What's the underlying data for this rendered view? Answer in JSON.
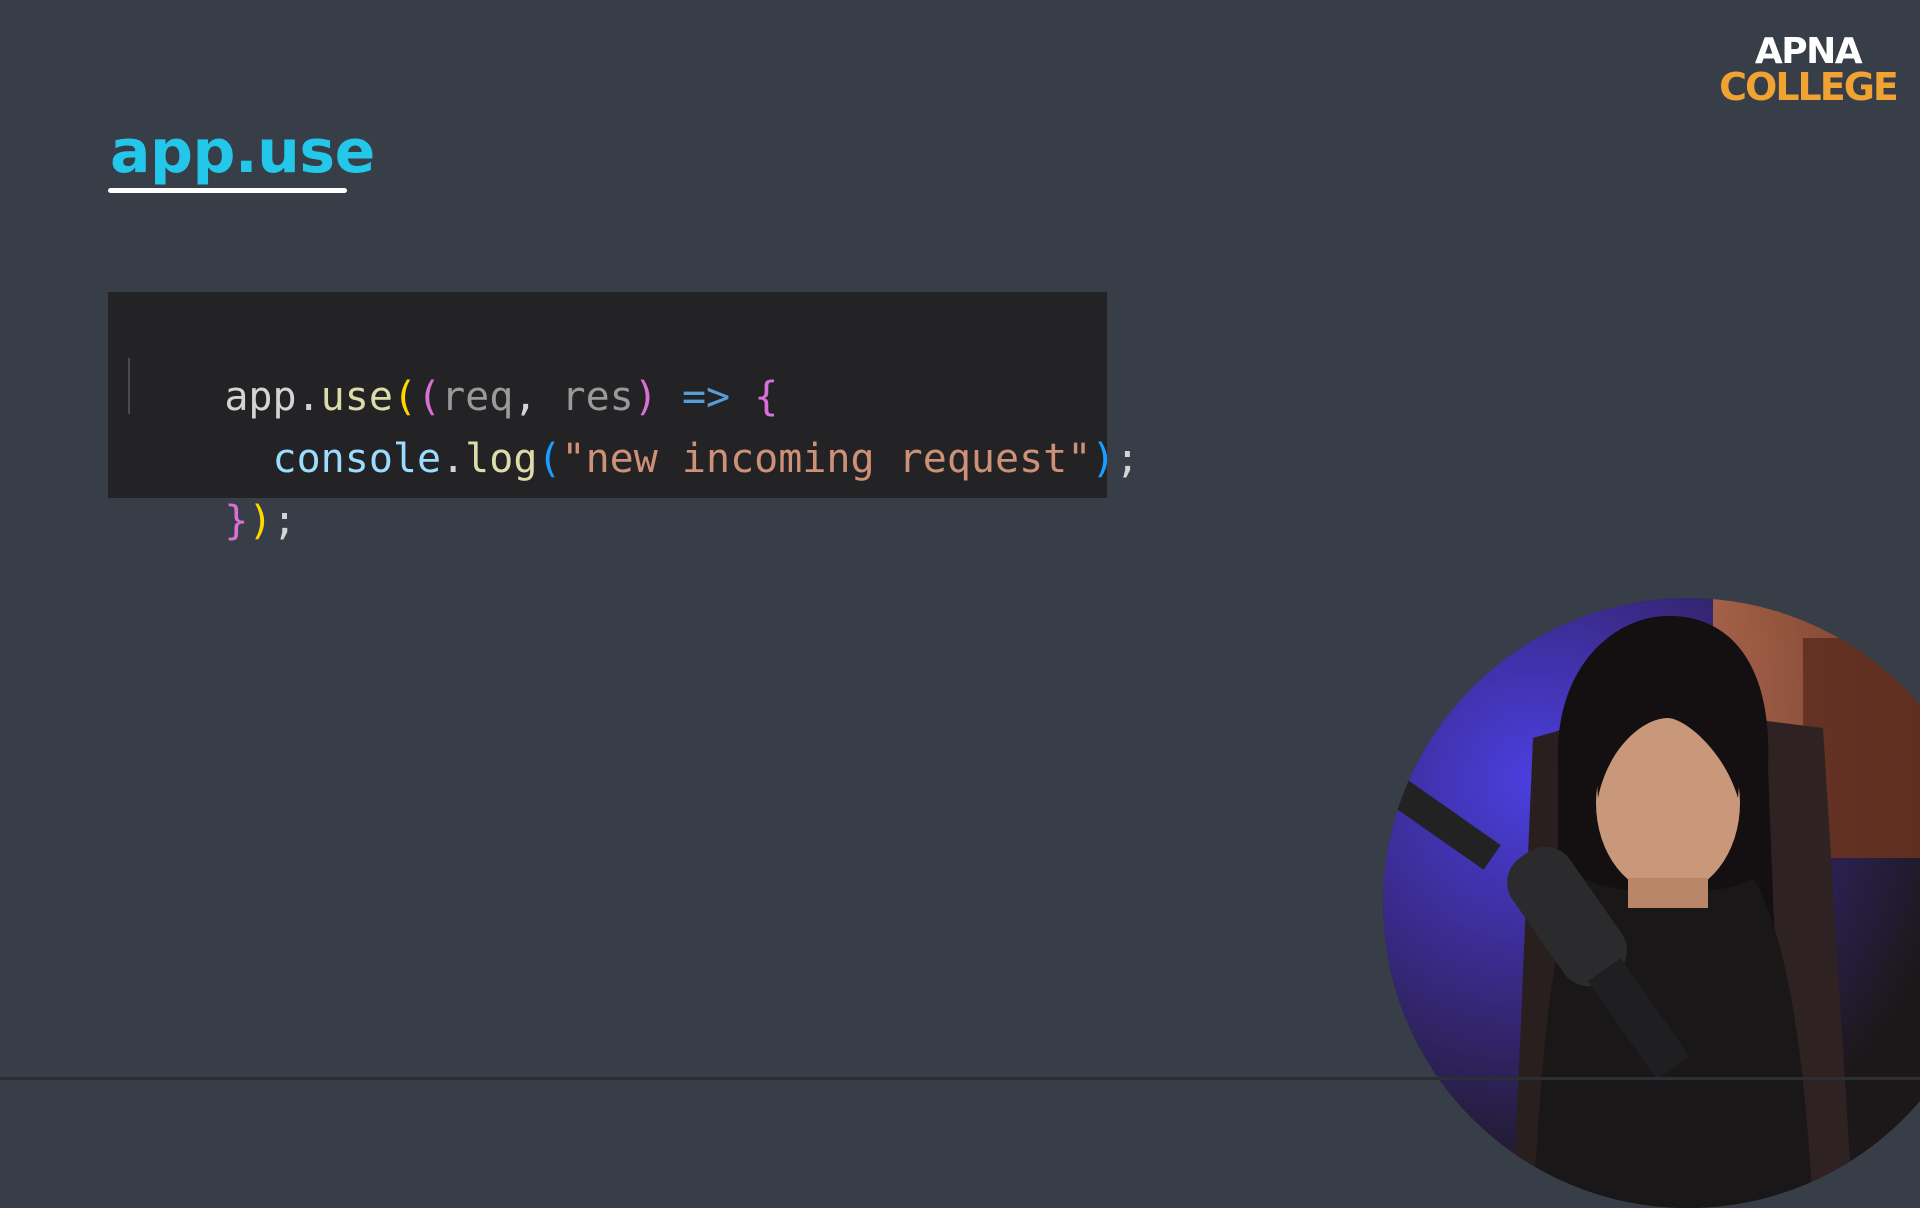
{
  "slide": {
    "title": "app.use"
  },
  "logo": {
    "line1": "APNA",
    "line2": "COLLEGE"
  },
  "code": {
    "lines": [
      [
        {
          "text": "app.",
          "type": "plain"
        },
        {
          "text": "use",
          "type": "func"
        },
        {
          "text": "(",
          "type": "paren-y"
        },
        {
          "text": "(",
          "type": "paren-p"
        },
        {
          "text": "req",
          "type": "param"
        },
        {
          "text": ", ",
          "type": "plain"
        },
        {
          "text": "res",
          "type": "param"
        },
        {
          "text": ")",
          "type": "paren-p"
        },
        {
          "text": " ",
          "type": "plain"
        },
        {
          "text": "=>",
          "type": "arrow"
        },
        {
          "text": " ",
          "type": "plain"
        },
        {
          "text": "{",
          "type": "paren-p"
        }
      ],
      [
        {
          "text": "  ",
          "type": "plain"
        },
        {
          "text": "console",
          "type": "var"
        },
        {
          "text": ".",
          "type": "plain"
        },
        {
          "text": "log",
          "type": "func"
        },
        {
          "text": "(",
          "type": "paren-b"
        },
        {
          "text": "\"new incoming request\"",
          "type": "string"
        },
        {
          "text": ")",
          "type": "paren-b"
        },
        {
          "text": ";",
          "type": "plain"
        }
      ],
      [
        {
          "text": "}",
          "type": "paren-p"
        },
        {
          "text": ")",
          "type": "paren-y"
        },
        {
          "text": ";",
          "type": "plain"
        }
      ]
    ]
  },
  "colors": {
    "background": "#373e47",
    "title": "#22c7ea",
    "logo_top": "#ffffff",
    "logo_bottom": "#f0a232",
    "code_background": "#232326"
  }
}
